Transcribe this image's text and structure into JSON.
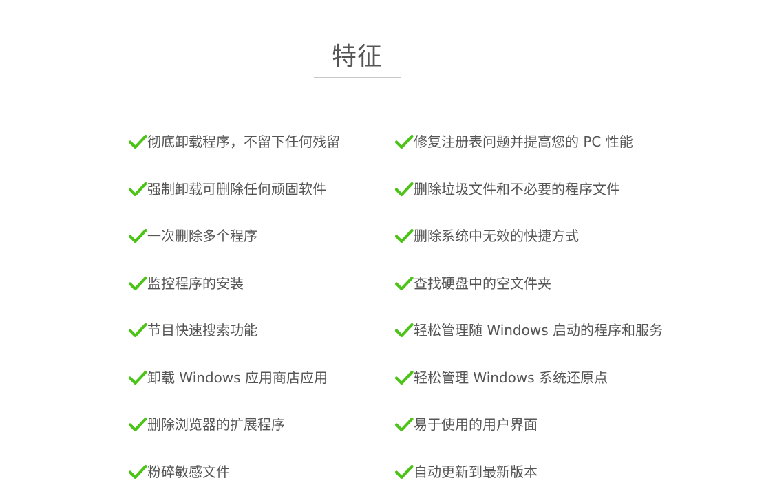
{
  "section": {
    "title": "特征"
  },
  "features": {
    "left": [
      {
        "label": "彻底卸载程序，不留下任何残留",
        "icon": "checkmark-icon"
      },
      {
        "label": "强制卸载可删除任何顽固软件",
        "icon": "checkmark-icon"
      },
      {
        "label": "一次删除多个程序",
        "icon": "checkmark-icon"
      },
      {
        "label": "监控程序的安装",
        "icon": "checkmark-icon"
      },
      {
        "label": "节目快速搜索功能",
        "icon": "checkmark-icon"
      },
      {
        "label": "卸载 Windows 应用商店应用",
        "icon": "checkmark-icon"
      },
      {
        "label": "删除浏览器的扩展程序",
        "icon": "checkmark-icon"
      },
      {
        "label": "粉碎敏感文件",
        "icon": "checkmark-icon"
      }
    ],
    "right": [
      {
        "label": "修复注册表问题并提高您的 PC 性能",
        "icon": "checkmark-icon"
      },
      {
        "label": "删除垃圾文件和不必要的程序文件",
        "icon": "checkmark-icon"
      },
      {
        "label": "删除系统中无效的快捷方式",
        "icon": "checkmark-icon"
      },
      {
        "label": "查找硬盘中的空文件夹",
        "icon": "checkmark-icon"
      },
      {
        "label": "轻松管理随 Windows 启动的程序和服务",
        "icon": "checkmark-icon"
      },
      {
        "label": "轻松管理 Windows 系统还原点",
        "icon": "checkmark-icon"
      },
      {
        "label": "易于使用的用户界面",
        "icon": "checkmark-icon"
      },
      {
        "label": "自动更新到最新版本",
        "icon": "checkmark-icon"
      }
    ]
  },
  "colors": {
    "check": "#4cc417",
    "text": "#555555",
    "underline": "#c8c8c8"
  }
}
